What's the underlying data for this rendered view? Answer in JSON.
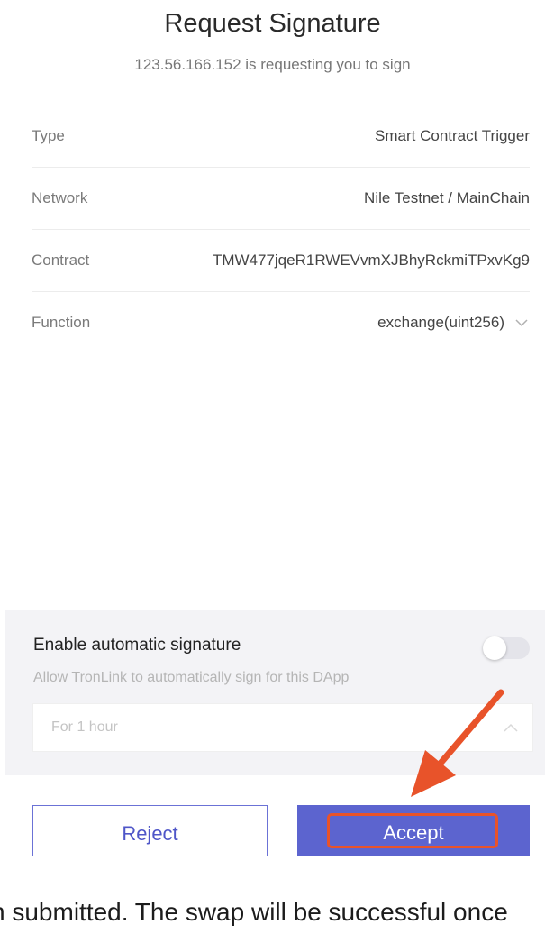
{
  "header": {
    "title": "Request Signature",
    "subtitle": "123.56.166.152 is requesting you to sign"
  },
  "details": [
    {
      "label": "Type",
      "value": "Smart Contract Trigger"
    },
    {
      "label": "Network",
      "value": "Nile Testnet / MainChain"
    },
    {
      "label": "Contract",
      "value": "TMW477jqeR1RWEVvmXJBhyRckmiTPxvKg9"
    },
    {
      "label": "Function",
      "value": "exchange(uint256)"
    }
  ],
  "auto_sign": {
    "title": "Enable automatic signature",
    "description": "Allow TronLink to automatically sign for this DApp",
    "enabled": false,
    "duration": "For 1 hour"
  },
  "actions": {
    "reject_label": "Reject",
    "accept_label": "Accept"
  },
  "footer_text": "n submitted. The swap will be successful once",
  "colors": {
    "primary": "#5c64cf",
    "annotation": "#e8532a",
    "panel_bg": "#f3f3f6"
  },
  "icons": [
    "chevron-down-icon",
    "chevron-up-icon",
    "annotation-arrow-icon"
  ]
}
